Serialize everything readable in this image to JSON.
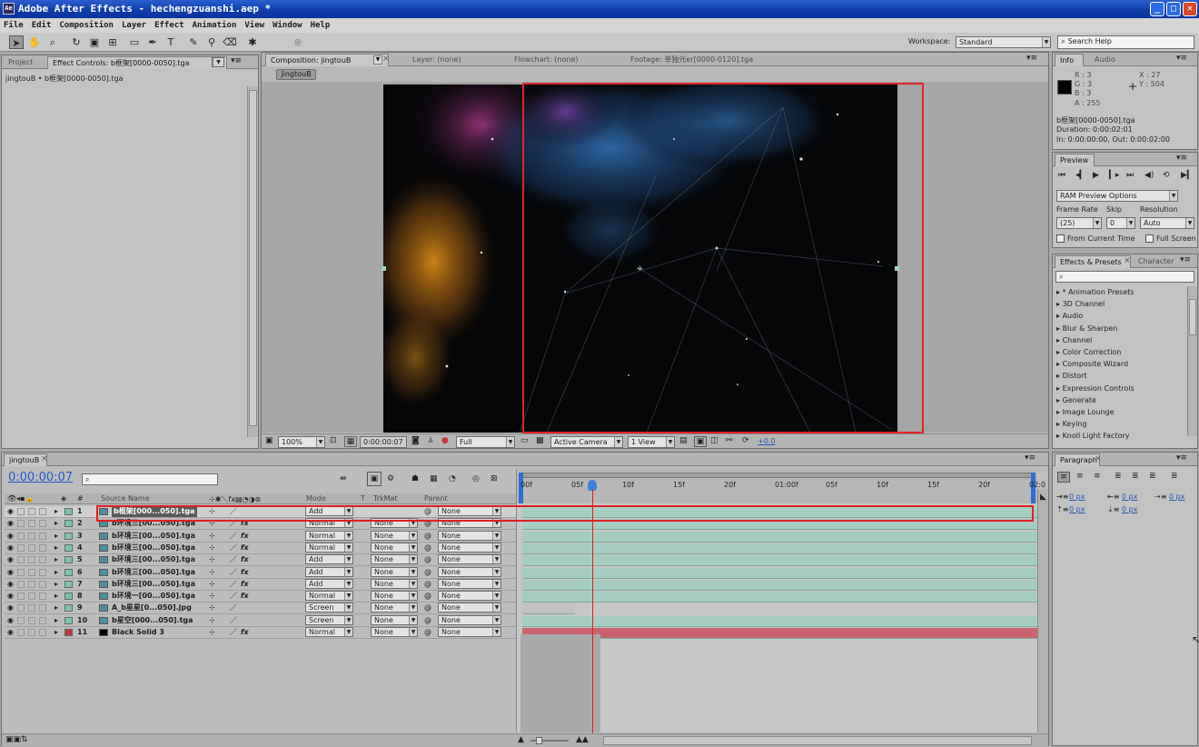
{
  "app": {
    "title": "Adobe After Effects - hechengzuanshi.aep *"
  },
  "menu": [
    "File",
    "Edit",
    "Composition",
    "Layer",
    "Effect",
    "Animation",
    "View",
    "Window",
    "Help"
  ],
  "toolbar": {
    "workspace_label": "Workspace:",
    "workspace_value": "Standard",
    "search_placeholder": "Search Help"
  },
  "project_panel": {
    "tab_project": "Project",
    "tab_effect_controls": "Effect Controls: b框架[0000-0050].tga",
    "breadcrumb": "jingtouB • b框架[0000-0050].tga"
  },
  "viewer": {
    "tab_composition": "Composition: jingtouB",
    "tab_layer": "Layer: (none)",
    "tab_flowchart": "Flowchart: (none)",
    "tab_footage": "Footage: 单独元er[0000-0120].tga",
    "comp_button": "jingtouB",
    "zoom": "100%",
    "timecode": "0:00:00:07",
    "resolution": "Full",
    "camera": "Active Camera",
    "views": "1 View",
    "exposure": "+0.0"
  },
  "info_panel": {
    "tab_info": "Info",
    "tab_audio": "Audio",
    "r": "R : 3",
    "g": "G : 3",
    "b": "B : 3",
    "a": "A : 255",
    "x": "X : 27",
    "y": "Y : 504",
    "file": "b框架[0000-0050].tga",
    "duration": "Duration: 0:00:02:01",
    "inout": "In: 0:00:00:00, Out: 0:00:02:00",
    "swatch_color": "#000000"
  },
  "preview_panel": {
    "tab": "Preview",
    "ram_options": "RAM Preview Options",
    "frame_rate_label": "Frame Rate",
    "skip_label": "Skip",
    "resolution_label": "Resolution",
    "frame_rate_value": "(25)",
    "skip_value": "0",
    "resolution_value": "Auto",
    "from_current": "From Current Time",
    "full_screen": "Full Screen"
  },
  "effects_panel": {
    "tab_effects": "Effects & Presets",
    "tab_character": "Character",
    "items": [
      "* Animation Presets",
      "3D Channel",
      "Audio",
      "Blur & Sharpen",
      "Channel",
      "Color Correction",
      "Composite Wizard",
      "Distort",
      "Expression Controls",
      "Generate",
      "Image Lounge",
      "Keying",
      "Knoll Light Factory"
    ]
  },
  "paragraph_panel": {
    "tab": "Paragraph",
    "values": [
      "0 px",
      "0 px",
      "0 px",
      "0 px",
      "0 px"
    ]
  },
  "timeline": {
    "tab": "jingtouB",
    "timecode": "0:00:00:07",
    "headers": {
      "source": "Source Name",
      "mode": "Mode",
      "t": "T",
      "trkmat": "TrkMat",
      "parent": "Parent",
      "num": "#"
    },
    "ruler": [
      "00f",
      "05f",
      "10f",
      "15f",
      "20f",
      "01:00f",
      "05f",
      "10f",
      "15f",
      "20f",
      "02:0"
    ],
    "layers": [
      {
        "num": "1",
        "name": "b框架[000...050].tga",
        "mode": "Add",
        "trk": "",
        "parent": "None",
        "fx": false,
        "color": "#a6cdc1"
      },
      {
        "num": "2",
        "name": "b环境三[00...050].tga",
        "mode": "Normal",
        "trk": "None",
        "parent": "None",
        "fx": true,
        "color": "#a6cdc1"
      },
      {
        "num": "3",
        "name": "b环境三[00...050].tga",
        "mode": "Normal",
        "trk": "None",
        "parent": "None",
        "fx": true,
        "color": "#a6cdc1"
      },
      {
        "num": "4",
        "name": "b环境三[00...050].tga",
        "mode": "Normal",
        "trk": "None",
        "parent": "None",
        "fx": true,
        "color": "#a6cdc1"
      },
      {
        "num": "5",
        "name": "b环境三[00...050].tga",
        "mode": "Add",
        "trk": "None",
        "parent": "None",
        "fx": true,
        "color": "#a6cdc1"
      },
      {
        "num": "6",
        "name": "b环境三[00...050].tga",
        "mode": "Add",
        "trk": "None",
        "parent": "None",
        "fx": true,
        "color": "#a6cdc1"
      },
      {
        "num": "7",
        "name": "b环境三[00...050].tga",
        "mode": "Add",
        "trk": "None",
        "parent": "None",
        "fx": true,
        "color": "#a6cdc1"
      },
      {
        "num": "8",
        "name": "b环境一[00...050].tga",
        "mode": "Normal",
        "trk": "None",
        "parent": "None",
        "fx": true,
        "color": "#a6cdc1"
      },
      {
        "num": "9",
        "name": "A_b星星[0...050].jpg",
        "mode": "Screen",
        "trk": "None",
        "parent": "None",
        "fx": false,
        "color": "#a6cdc1"
      },
      {
        "num": "10",
        "name": "b星空[000...050].tga",
        "mode": "Screen",
        "trk": "None",
        "parent": "None",
        "fx": false,
        "color": "#a6cdc1"
      },
      {
        "num": "11",
        "name": "Black Solid 3",
        "mode": "Normal",
        "trk": "None",
        "parent": "None",
        "fx": true,
        "color": "#c9646e"
      }
    ]
  }
}
